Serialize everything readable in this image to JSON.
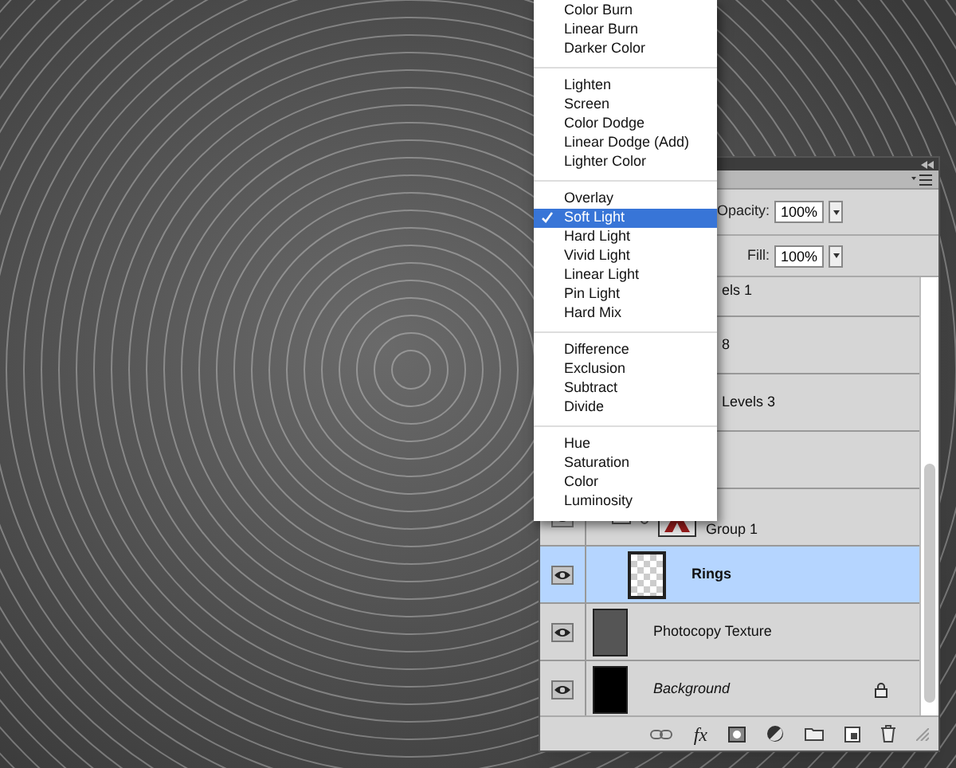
{
  "blend_menu": {
    "groups": [
      [
        {
          "label": "Color Burn",
          "selected": false
        },
        {
          "label": "Linear Burn",
          "selected": false
        },
        {
          "label": "Darker Color",
          "selected": false
        }
      ],
      [
        {
          "label": "Lighten",
          "selected": false
        },
        {
          "label": "Screen",
          "selected": false
        },
        {
          "label": "Color Dodge",
          "selected": false
        },
        {
          "label": "Linear Dodge (Add)",
          "selected": false
        },
        {
          "label": "Lighter Color",
          "selected": false
        }
      ],
      [
        {
          "label": "Overlay",
          "selected": false
        },
        {
          "label": "Soft Light",
          "selected": true
        },
        {
          "label": "Hard Light",
          "selected": false
        },
        {
          "label": "Vivid Light",
          "selected": false
        },
        {
          "label": "Linear Light",
          "selected": false
        },
        {
          "label": "Pin Light",
          "selected": false
        },
        {
          "label": "Hard Mix",
          "selected": false
        }
      ],
      [
        {
          "label": "Difference",
          "selected": false
        },
        {
          "label": "Exclusion",
          "selected": false
        },
        {
          "label": "Subtract",
          "selected": false
        },
        {
          "label": "Divide",
          "selected": false
        }
      ],
      [
        {
          "label": "Hue",
          "selected": false
        },
        {
          "label": "Saturation",
          "selected": false
        },
        {
          "label": "Color",
          "selected": false
        },
        {
          "label": "Luminosity",
          "selected": false
        }
      ]
    ]
  },
  "layers_panel": {
    "opacity": {
      "label": "Opacity:",
      "value": "100%"
    },
    "fill": {
      "label": "Fill:",
      "value": "100%"
    },
    "layers": [
      {
        "name": "els 1",
        "selected": false
      },
      {
        "name": "8",
        "selected": false
      },
      {
        "name": "Levels 3",
        "selected": false
      },
      {
        "selected": false
      },
      {
        "name": "Group 1",
        "kind": "group",
        "selected": false,
        "visible": true,
        "expanded": true,
        "children": [
          {
            "name": "Rings",
            "kind": "transparent",
            "selected": true,
            "visible": true
          }
        ]
      },
      {
        "name": "Photocopy Texture",
        "kind": "texture",
        "selected": false,
        "visible": true
      },
      {
        "name": "Background",
        "kind": "background",
        "selected": false,
        "visible": true,
        "locked": true
      }
    ],
    "toolbar": {
      "fx": "fx"
    }
  }
}
